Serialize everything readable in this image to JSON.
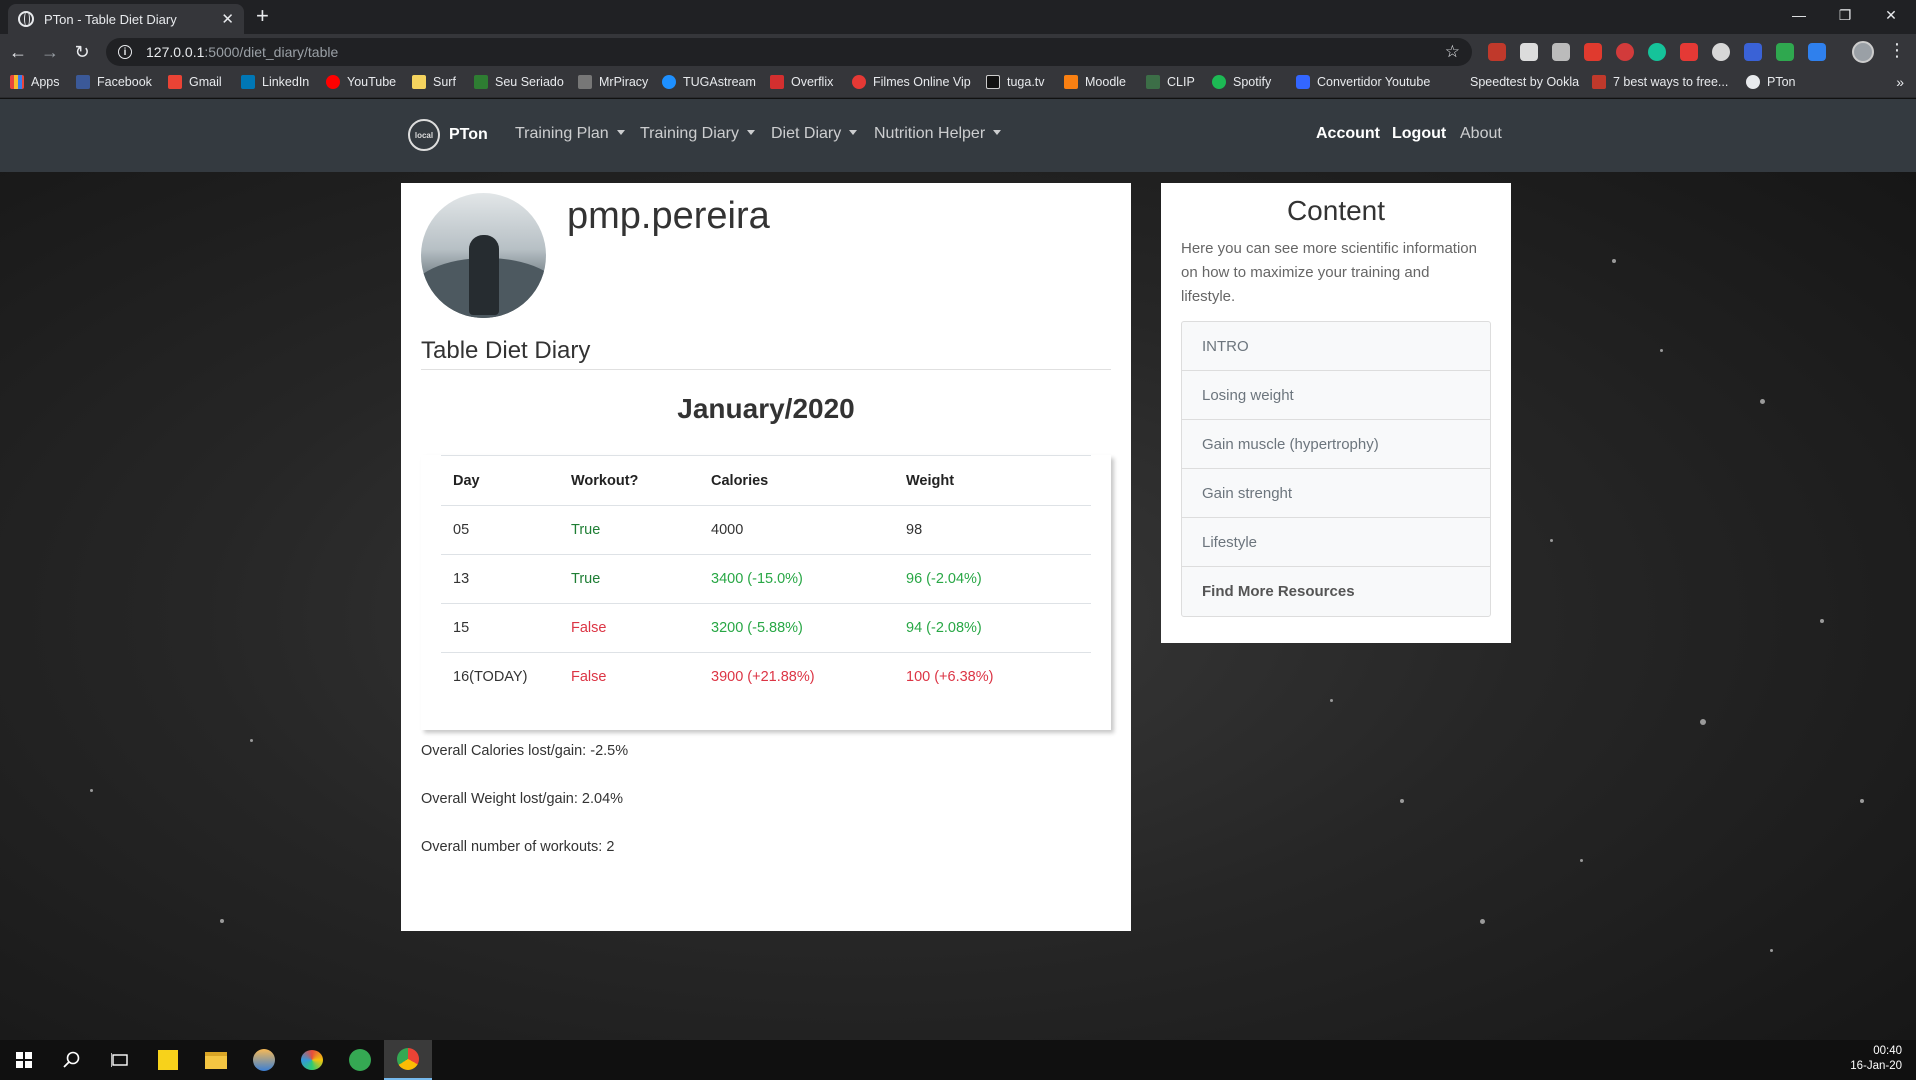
{
  "browser": {
    "tab_title": "PTon - Table Diet Diary",
    "url_host": "127.0.0.1",
    "url_path": ":5000/diet_diary/table",
    "bookmarks": [
      "Apps",
      "Facebook",
      "Gmail",
      "LinkedIn",
      "YouTube",
      "Surf",
      "Seu Seriado",
      "MrPiracy",
      "TUGAstream",
      "Overflix",
      "Filmes Online Vip",
      "tuga.tv",
      "Moodle",
      "CLIP",
      "Spotify",
      "Convertidor Youtube",
      "Speedtest by Ookla",
      "7 best ways to free...",
      "PTon"
    ],
    "bookmarks_more": "»"
  },
  "navbar": {
    "brand": "PTon",
    "logo_text": "local",
    "training_plan": "Training Plan",
    "training_diary": "Training Diary",
    "diet_diary": "Diet Diary",
    "nutrition_helper": "Nutrition Helper",
    "account": "Account",
    "logout": "Logout",
    "about": "About"
  },
  "profile": {
    "username": "pmp.pereira"
  },
  "diary": {
    "section_title": "Table Diet Diary",
    "month": "January/2020",
    "headers": [
      "Day",
      "Workout?",
      "Calories",
      "Weight"
    ],
    "rows": [
      {
        "day": "05",
        "workout": "True",
        "calories": "4000",
        "weight": "98"
      },
      {
        "day": "13",
        "workout": "True",
        "calories": "3400 (-15.0%)",
        "weight": "96 (-2.04%)"
      },
      {
        "day": "15",
        "workout": "False",
        "calories": "3200 (-5.88%)",
        "weight": "94 (-2.08%)"
      },
      {
        "day": "16(TODAY)",
        "workout": "False",
        "calories": "3900 (+21.88%)",
        "weight": "100 (+6.38%)"
      }
    ],
    "summary_calories": "Overall Calories lost/gain: -2.5%",
    "summary_weight": "Overall Weight lost/gain: 2.04%",
    "summary_workouts": "Overall number of workouts: 2"
  },
  "content": {
    "title": "Content",
    "description": "Here you can see more scientific information on how to maximize your training and lifestyle.",
    "items": [
      "INTRO",
      "Losing weight",
      "Gain muscle (hypertrophy)",
      "Gain strenght",
      "Lifestyle",
      "Find More Resources"
    ]
  },
  "taskbar": {
    "time": "00:40",
    "date": "16-Jan-20"
  },
  "colors": {
    "positive": "#28a745",
    "negative": "#dc3545",
    "navbar": "#343a40"
  }
}
